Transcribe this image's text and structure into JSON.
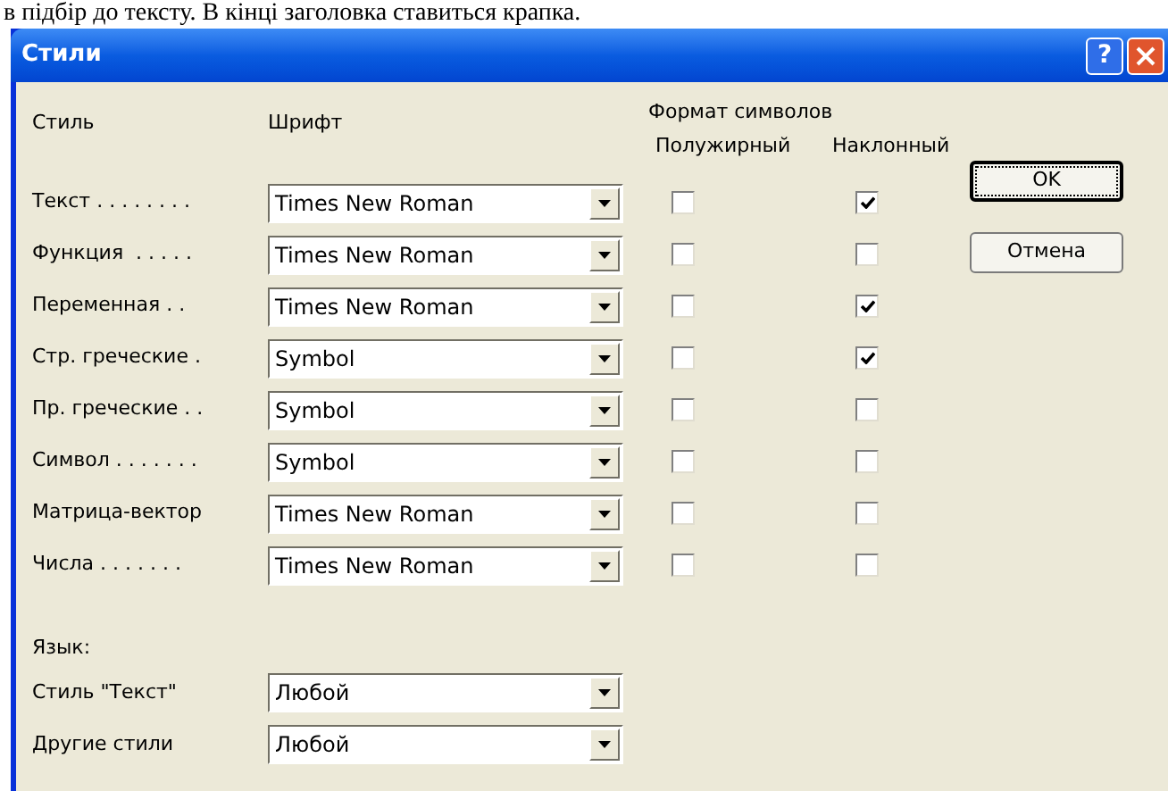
{
  "background_text": "в підбір до тексту. В кінці заголовка ставиться крапка.",
  "window": {
    "title": "Стили",
    "help_button": "?"
  },
  "columns": {
    "style": "Стиль",
    "font": "Шрифт",
    "format": "Формат символов",
    "bold": "Полужирный",
    "italic": "Наклонный"
  },
  "styles": [
    {
      "label": "Текст . . . . . . . .",
      "font": "Times New Roman",
      "bold": false,
      "italic": true
    },
    {
      "label": "Функция  . . . . .",
      "font": "Times New Roman",
      "bold": false,
      "italic": false
    },
    {
      "label": "Переменная . .",
      "font": "Times New Roman",
      "bold": false,
      "italic": true
    },
    {
      "label": "Стр. греческие .",
      "font": "Symbol",
      "bold": false,
      "italic": true
    },
    {
      "label": "Пр. греческие . .",
      "font": "Symbol",
      "bold": false,
      "italic": false
    },
    {
      "label": "Символ . . . . . . .",
      "font": "Symbol",
      "bold": false,
      "italic": false
    },
    {
      "label": "Матрица-вектор",
      "font": "Times New Roman",
      "bold": false,
      "italic": false
    },
    {
      "label": "Числа . . . . . . .",
      "font": "Times New Roman",
      "bold": false,
      "italic": false
    }
  ],
  "language": {
    "heading": "Язык:",
    "rows": [
      {
        "label": "Стиль \"Текст\"",
        "value": "Любой"
      },
      {
        "label": "Другие стили",
        "value": "Любой"
      }
    ]
  },
  "buttons": [
    {
      "label": "OK",
      "kind": "default"
    },
    {
      "label": "Отмена",
      "kind": "normal"
    }
  ]
}
